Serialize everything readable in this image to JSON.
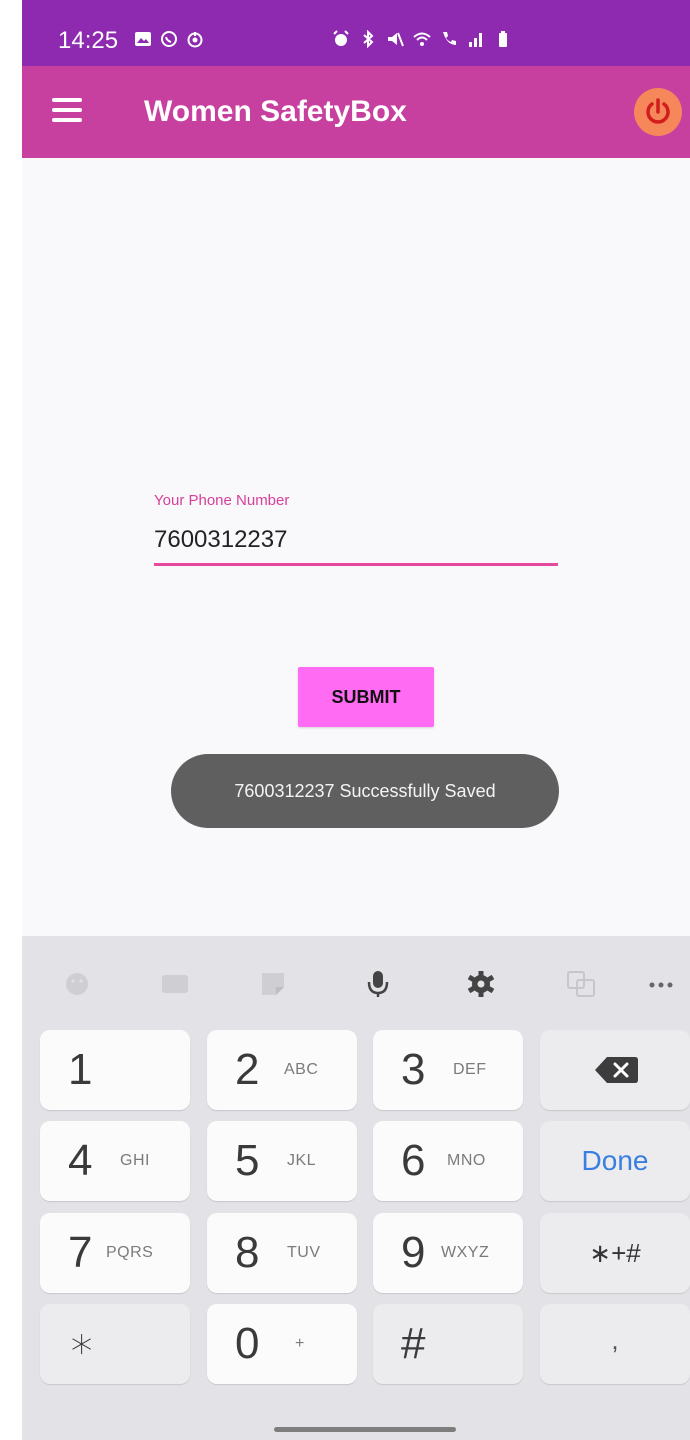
{
  "status_bar": {
    "time": "14:25",
    "icons_left": [
      "gallery-icon",
      "whatsapp-icon",
      "target-icon"
    ],
    "icons_right": [
      "alarm-icon",
      "bluetooth-icon",
      "mute-icon",
      "wifi-icon",
      "call-icon",
      "signal-icon",
      "battery-icon"
    ]
  },
  "app_bar": {
    "title": "Women SafetyBox",
    "menu_icon": "hamburger-menu-icon",
    "power_icon": "power-icon"
  },
  "form": {
    "phone_label": "Your Phone Number",
    "phone_value": "7600312237",
    "submit_label": "SUBMIT"
  },
  "toast": {
    "message": "7600312237 Successfully Saved"
  },
  "keyboard": {
    "toolbar_icons": [
      "emoji-icon",
      "gif-icon",
      "sticker-icon",
      "microphone-icon",
      "settings-icon",
      "translate-icon",
      "more-icon"
    ],
    "keys": [
      {
        "num": "1",
        "letters": ""
      },
      {
        "num": "2",
        "letters": "ABC"
      },
      {
        "num": "3",
        "letters": "DEF"
      },
      {
        "num": "4",
        "letters": "GHI"
      },
      {
        "num": "5",
        "letters": "JKL"
      },
      {
        "num": "6",
        "letters": "MNO"
      },
      {
        "num": "7",
        "letters": "PQRS"
      },
      {
        "num": "8",
        "letters": "TUV"
      },
      {
        "num": "9",
        "letters": "WXYZ"
      },
      {
        "num": "∗",
        "letters": ""
      },
      {
        "num": "0",
        "letters": "+"
      },
      {
        "num": "#",
        "letters": ""
      }
    ],
    "backspace_icon": "backspace-icon",
    "done_label": "Done",
    "symbols_label": "∗+#",
    "comma_label": ","
  },
  "colors": {
    "status_bar": "#8e2ab0",
    "app_bar": "#c7409f",
    "accent": "#e64a9e",
    "submit": "#ff6bf2",
    "power": "#f5875a",
    "done": "#3a7ee0"
  }
}
